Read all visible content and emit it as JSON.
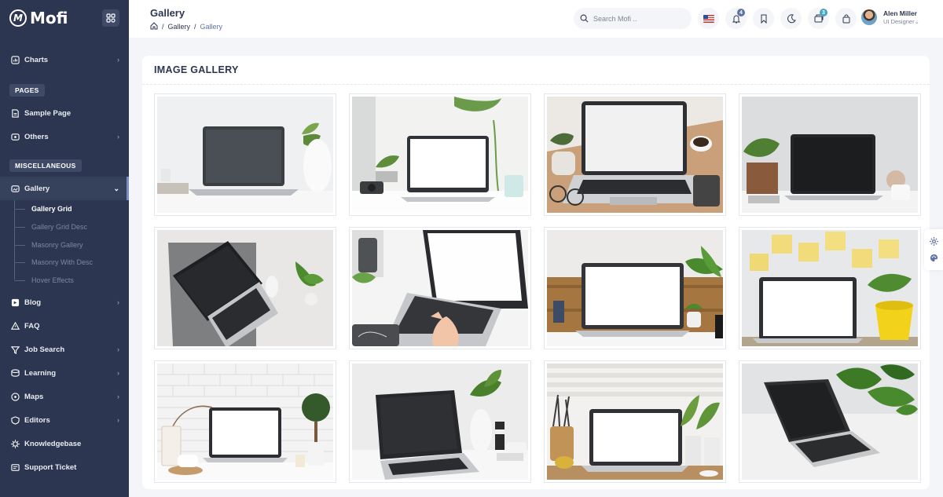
{
  "brand": {
    "name": "Mofi"
  },
  "sidebar": {
    "top_items": [
      {
        "label": "Charts",
        "icon": "chart-icon"
      }
    ],
    "sections": [
      {
        "tag": "PAGES",
        "items": [
          {
            "label": "Sample Page",
            "icon": "page-icon"
          },
          {
            "label": "Others",
            "icon": "circle-icon"
          }
        ]
      },
      {
        "tag": "MISCELLANEOUS"
      }
    ],
    "gallery": {
      "label": "Gallery",
      "icon": "image-icon"
    },
    "gallery_sub": [
      "Gallery Grid",
      "Gallery Grid Desc",
      "Masonry Gallery",
      "Masonry With Desc",
      "Hover Effects"
    ],
    "bottom_items": [
      {
        "label": "Blog",
        "icon": "blog-icon"
      },
      {
        "label": "FAQ",
        "icon": "faq-icon"
      },
      {
        "label": "Job Search",
        "icon": "filter-icon"
      },
      {
        "label": "Learning",
        "icon": "learning-icon"
      },
      {
        "label": "Maps",
        "icon": "map-icon"
      },
      {
        "label": "Editors",
        "icon": "editor-icon"
      },
      {
        "label": "Knowledgebase",
        "icon": "knowledge-icon"
      },
      {
        "label": "Support Ticket",
        "icon": "ticket-icon"
      }
    ]
  },
  "header": {
    "title": "Gallery",
    "breadcrumb": [
      "Gallery",
      "Gallery"
    ],
    "search_placeholder": "Search Mofi ..",
    "notifications_count": "4",
    "cart_count": "3",
    "user": {
      "name": "Alen Miller",
      "role": "UI Designer"
    }
  },
  "main": {
    "card_title": "IMAGE GALLERY",
    "photos": [
      "laptop-on-desk-with-vase",
      "laptop-with-camera-and-plant",
      "laptop-with-coffee-and-glasses",
      "laptop-with-potted-plant",
      "laptop-on-grey-mat-top-view",
      "hands-typing-on-laptop",
      "laptop-on-wooden-desk",
      "laptop-with-sticky-notes",
      "laptop-with-white-bricks",
      "laptop-with-vase-and-cup",
      "laptop-with-pencil-holder",
      "laptop-with-monstera-leaves"
    ]
  },
  "colors": {
    "sidebar": "#2c3650",
    "accent": "#5f73a8",
    "badge_blue": "#5f73a8",
    "badge_teal": "#45a3c3"
  }
}
